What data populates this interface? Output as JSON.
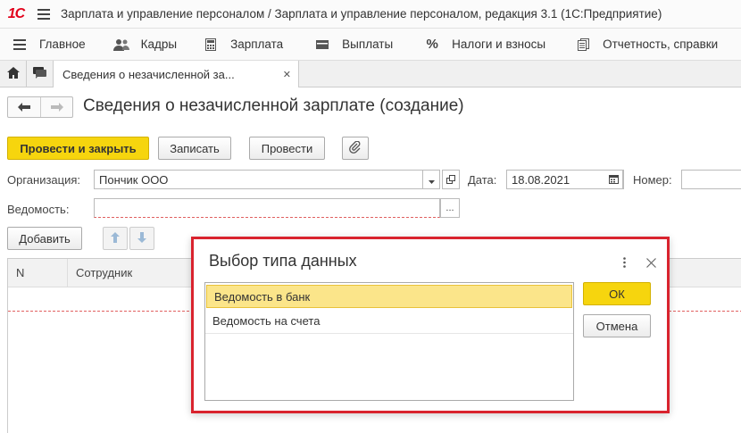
{
  "app": {
    "logo_text": "1С",
    "title": "Зарплата и управление персоналом / Зарплата и управление персоналом, редакция 3.1  (1С:Предприятие)"
  },
  "sections": [
    {
      "label": "Главное",
      "icon": "menu-icon"
    },
    {
      "label": "Кадры",
      "icon": "people-icon"
    },
    {
      "label": "Зарплата",
      "icon": "calculator-icon"
    },
    {
      "label": "Выплаты",
      "icon": "wallet-icon"
    },
    {
      "label": "Налоги и взносы",
      "icon": "percent-icon"
    },
    {
      "label": "Отчетность, справки",
      "icon": "reports-icon"
    }
  ],
  "tabs": {
    "open_doc_label": "Сведения о незачисленной за...",
    "close_symbol": "✕"
  },
  "page": {
    "title": "Сведения о незачисленной зарплате (создание)"
  },
  "toolbar": {
    "post_close_label": "Провести и закрыть",
    "save_label": "Записать",
    "post_label": "Провести"
  },
  "form": {
    "org_label": "Организация:",
    "org_value": "Пончик ООО",
    "date_label": "Дата:",
    "date_value": "18.08.2021",
    "number_label": "Номер:",
    "number_value": "",
    "statement_label": "Ведомость:",
    "statement_value": "",
    "add_label": "Добавить"
  },
  "table": {
    "columns": [
      "N",
      "Сотрудник"
    ]
  },
  "dialog": {
    "title": "Выбор типа данных",
    "items": [
      "Ведомость в банк",
      "Ведомость на счета"
    ],
    "selected_index": 0,
    "ok_label": "ОК",
    "cancel_label": "Отмена"
  },
  "colors": {
    "accent_yellow": "#f6d50e",
    "highlight_border": "#d9232e",
    "selected_row": "#fbe58a"
  }
}
